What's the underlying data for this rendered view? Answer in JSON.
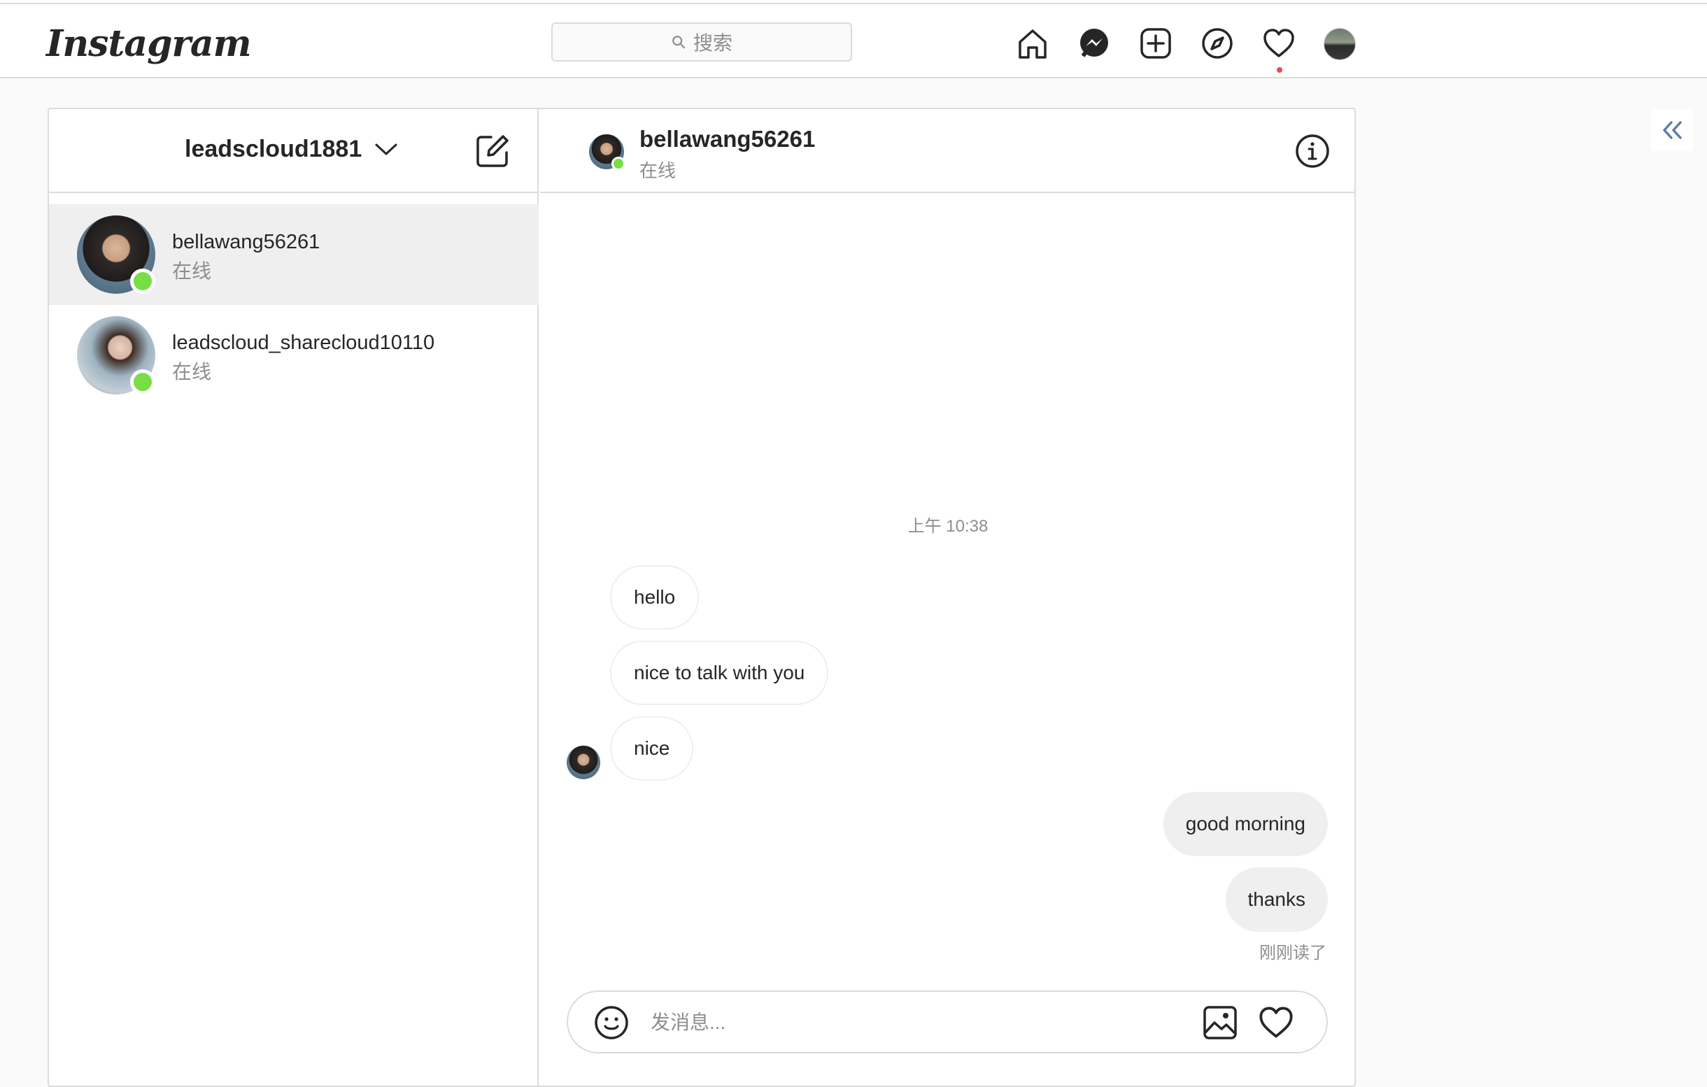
{
  "nav": {
    "logo": "Instagram",
    "search_placeholder": "搜索",
    "icons": [
      "home-icon",
      "messenger-icon",
      "new-post-icon",
      "explore-icon",
      "activity-heart-icon",
      "profile-avatar"
    ],
    "notification_color": "#ed4956"
  },
  "sidebar": {
    "account_name": "leadscloud1881",
    "threads": [
      {
        "name": "bellawang56261",
        "status": "在线",
        "active": true
      },
      {
        "name": "leadscloud_sharecloud10110",
        "status": "在线",
        "active": false
      }
    ]
  },
  "chat": {
    "name": "bellawang56261",
    "status": "在线",
    "timestamp": "上午 10:38",
    "messages": [
      {
        "text": "hello",
        "direction": "in"
      },
      {
        "text": "nice to talk with you",
        "direction": "in"
      },
      {
        "text": "nice",
        "direction": "in"
      },
      {
        "text": "good morning",
        "direction": "out"
      },
      {
        "text": "thanks",
        "direction": "out"
      }
    ],
    "read_receipt": "刚刚读了",
    "composer_placeholder": "发消息..."
  },
  "colors": {
    "online": "#78de45",
    "border": "#dbdbdb",
    "muted_text": "#8e8e8e"
  }
}
